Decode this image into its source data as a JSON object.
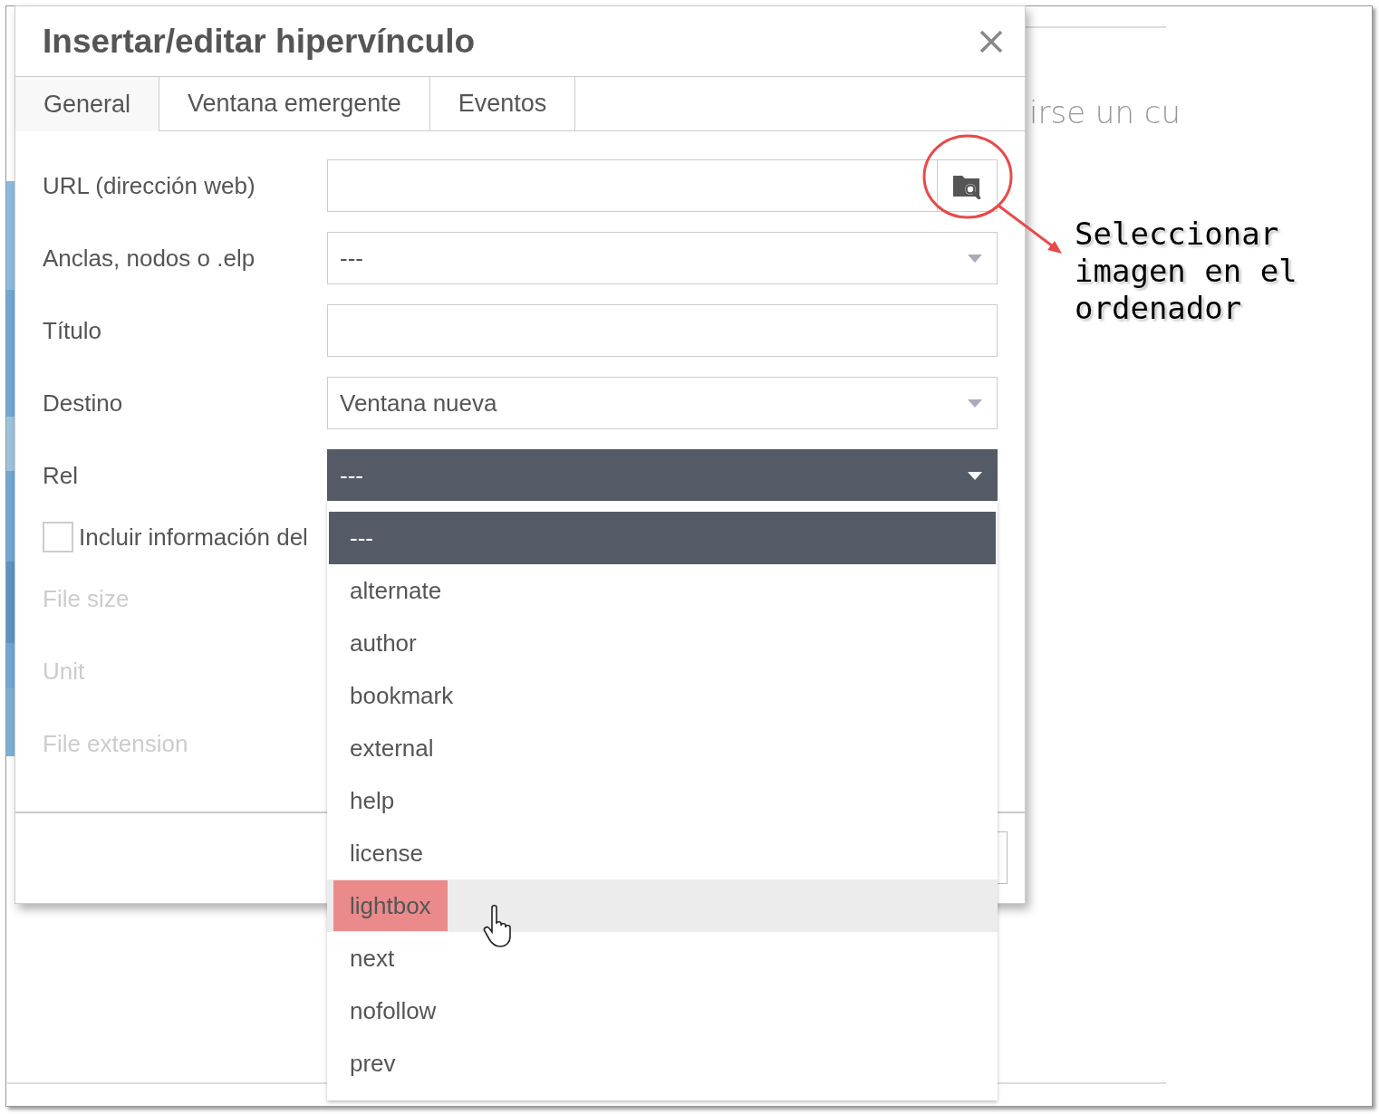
{
  "background": {
    "text": "irse un cu"
  },
  "dialog": {
    "title": "Insertar/editar hipervínculo",
    "tabs": [
      {
        "label": "General",
        "selected": true
      },
      {
        "label": "Ventana emergente",
        "selected": false
      },
      {
        "label": "Eventos",
        "selected": false
      }
    ],
    "fields": [
      {
        "kind": "browse",
        "label": "URL (dirección web)"
      },
      {
        "kind": "select",
        "label": "Anclas, nodos o .elp",
        "value": "---",
        "open": false
      },
      {
        "kind": "input",
        "label": "Título"
      },
      {
        "kind": "select",
        "label": "Destino",
        "value": "Ventana nueva",
        "open": false
      },
      {
        "kind": "select",
        "label": "Rel",
        "value": "---",
        "open": true
      }
    ],
    "checkbox": {
      "label": "Incluir información del",
      "checked": false
    },
    "extra_fields": [
      {
        "label": "File size",
        "disabled": true
      },
      {
        "label": "Unit",
        "disabled": true
      },
      {
        "label": "File extension",
        "disabled": true
      }
    ]
  },
  "dropdown": {
    "options": [
      {
        "label": "---",
        "selected": true,
        "hovered": false,
        "highlighted": false
      },
      {
        "label": "alternate",
        "selected": false,
        "hovered": false,
        "highlighted": false
      },
      {
        "label": "author",
        "selected": false,
        "hovered": false,
        "highlighted": false
      },
      {
        "label": "bookmark",
        "selected": false,
        "hovered": false,
        "highlighted": false
      },
      {
        "label": "external",
        "selected": false,
        "hovered": false,
        "highlighted": false
      },
      {
        "label": "help",
        "selected": false,
        "hovered": false,
        "highlighted": false
      },
      {
        "label": "license",
        "selected": false,
        "hovered": false,
        "highlighted": false
      },
      {
        "label": "lightbox",
        "selected": false,
        "hovered": true,
        "highlighted": true
      },
      {
        "label": "next",
        "selected": false,
        "hovered": false,
        "highlighted": false
      },
      {
        "label": "nofollow",
        "selected": false,
        "hovered": false,
        "highlighted": false
      },
      {
        "label": "prev",
        "selected": false,
        "hovered": false,
        "highlighted": false
      }
    ]
  },
  "annotation": {
    "text": "Seleccionar imagen en el ordenador"
  }
}
